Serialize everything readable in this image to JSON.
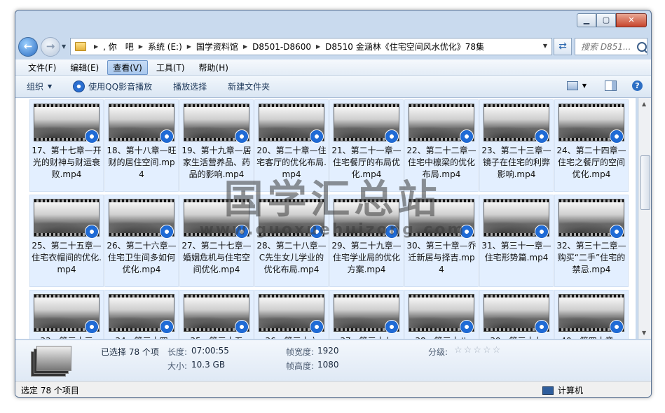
{
  "window": {
    "min_glyph": "▁",
    "max_glyph": "▢",
    "close_glyph": "✕"
  },
  "address": {
    "crumbs": [
      ", 你　吧",
      "系统 (E:)",
      "国学资料馆",
      "D8501-D8600",
      "D8510 金涵林《住宅空间风水优化》78集"
    ],
    "search_placeholder": "搜索 D851..."
  },
  "menu": [
    "文件(F)",
    "编辑(E)",
    "查看(V)",
    "工具(T)",
    "帮助(H)"
  ],
  "toolbar": {
    "organize": "组织",
    "qq_play": "使用QQ影音播放",
    "playlist": "播放选择",
    "new_folder": "新建文件夹"
  },
  "files": [
    "17、第十七章—开光的财神与财运衰败.mp4",
    "18、第十八章—旺财的居住空间.mp4",
    "19、第十九章—居家生活营养品、药品的影响.mp4",
    "20、第二十章—住宅客厅的优化布局.mp4",
    "21、第二十一章—住宅餐厅的布局优化.mp4",
    "22、第二十二章—住宅中檩梁的优化布局.mp4",
    "23、第二十三章—镜子在住宅的利弊影响.mp4",
    "24、第二十四章—住宅之餐厅的空间优化.mp4",
    "25、第二十五章—住宅衣帽间的优化.mp4",
    "26、第二十六章—住宅卫生间多如何优化.mp4",
    "27、第二十七章—婚姻危机与住宅空间优化.mp4",
    "28、第二十八章—C先生女儿学业的优化布局.mp4",
    "29、第二十九章—住宅学业局的优化方案.mp4",
    "30、第三十章—乔迁新居与择吉.mp4",
    "31、第三十一章—住宅形势篇.mp4",
    "32、第三十二章—购买“二手”住宅的禁忌.mp4",
    "33、第三十三",
    "34、第三十四",
    "35、第三十五",
    "36、第三十六",
    "37、第三十七",
    "38、第三十八",
    "39、第三十九",
    "40、第四十章—"
  ],
  "details": {
    "selected": "已选择 78 个项",
    "duration_label": "长度:",
    "duration": "07:00:55",
    "size_label": "大小:",
    "size": "10.3 GB",
    "width_label": "帧宽度:",
    "width": "1920",
    "height_label": "帧高度:",
    "height": "1080",
    "rating_label": "分级:",
    "rating_stars": "☆☆☆☆☆"
  },
  "status": {
    "left": "选定 78 个项目",
    "right": "计算机"
  },
  "watermark": {
    "cn": "国学汇总站",
    "url": "www.guoxuehuizong.com"
  }
}
